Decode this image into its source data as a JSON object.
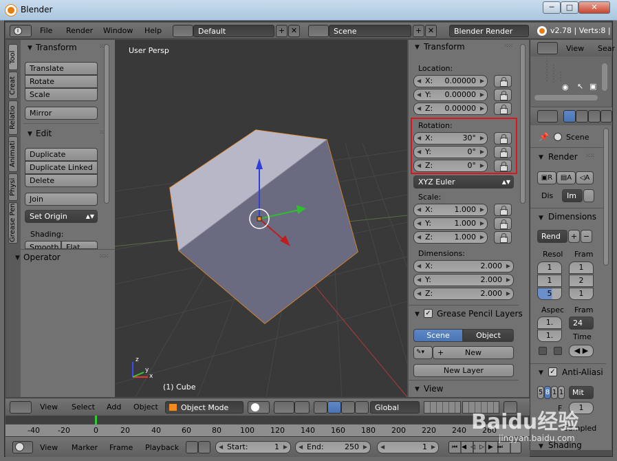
{
  "window": {
    "title": "Blender",
    "min": "─",
    "max": "□",
    "close": "✕"
  },
  "topbar": {
    "menus": [
      "File",
      "Render",
      "Window",
      "Help"
    ],
    "layout": "Default",
    "scene": "Scene",
    "engine": "Blender Render",
    "stats": "v2.78 | Verts:8 |"
  },
  "tool_tabs": [
    "Tool",
    "Creat",
    "Relatio",
    "Animati",
    "Physi",
    "Grease Pen"
  ],
  "tool_panel": {
    "transform_title": "Transform",
    "transform_buttons": [
      "Translate",
      "Rotate",
      "Scale"
    ],
    "mirror": "Mirror",
    "edit_title": "Edit",
    "edit_buttons": [
      "Duplicate",
      "Duplicate Linked",
      "Delete"
    ],
    "join": "Join",
    "set_origin": "Set Origin",
    "shading_label": "Shading:",
    "smooth": "Smooth",
    "flat": "Flat",
    "operator_title": "Operator"
  },
  "viewport": {
    "persp_label": "User Persp",
    "object_label": "(1) Cube",
    "axis_z": "z",
    "axis_x": "x",
    "axis_y": "y"
  },
  "props_panel": {
    "title": "Transform",
    "location_label": "Location:",
    "location": [
      {
        "axis": "X:",
        "value": "0.00000"
      },
      {
        "axis": "Y:",
        "value": "0.00000"
      },
      {
        "axis": "Z:",
        "value": "0.00000"
      }
    ],
    "rotation_label": "Rotation:",
    "rotation": [
      {
        "axis": "X:",
        "value": "30°"
      },
      {
        "axis": "Y:",
        "value": "0°"
      },
      {
        "axis": "Z:",
        "value": "0°"
      }
    ],
    "rotation_mode": "XYZ Euler",
    "scale_label": "Scale:",
    "scale": [
      {
        "axis": "X:",
        "value": "1.000"
      },
      {
        "axis": "Y:",
        "value": "1.000"
      },
      {
        "axis": "Z:",
        "value": "1.000"
      }
    ],
    "dimensions_label": "Dimensions:",
    "dimensions": [
      {
        "axis": "X:",
        "value": "2.000"
      },
      {
        "axis": "Y:",
        "value": "2.000"
      },
      {
        "axis": "Z:",
        "value": "2.000"
      }
    ],
    "gp_layers": "Grease Pencil Layers",
    "gp_scene": "Scene",
    "gp_object": "Object",
    "gp_new": "New",
    "gp_new_layer": "New Layer",
    "view_title": "View"
  },
  "outliner": {
    "view": "View",
    "search": "Sear"
  },
  "properties": {
    "scene": "Scene",
    "render_title": "Render",
    "render_btns": [
      "R",
      "A",
      "A"
    ],
    "display_label": "Dis",
    "display_value": "Im",
    "dimensions_title": "Dimensions",
    "preset": "Rend",
    "resol_label": "Resol",
    "resol_vals": [
      "1",
      "1",
      "5"
    ],
    "frame_label": "Fram",
    "frame_vals": [
      "1",
      "2",
      "1"
    ],
    "aspect_label": "Aspec",
    "aspect_vals": [
      "1.",
      "1."
    ],
    "framerate_label": "Fram",
    "framerate_val": "24",
    "time_label": "Time",
    "aa_title": "Anti-Aliasi",
    "aa_samples": [
      "5",
      "8",
      "1",
      "1"
    ],
    "aa_filter": "Mit",
    "aa_size": "1",
    "aa_full": "F",
    "sampled": "Sampled",
    "shading": "Shading"
  },
  "view3d_header": {
    "menus": [
      "View",
      "Select",
      "Add",
      "Object"
    ],
    "mode": "Object Mode",
    "orientation": "Global"
  },
  "timeline": {
    "ticks": [
      "-40",
      "-20",
      "0",
      "20",
      "40",
      "60",
      "80",
      "100",
      "120",
      "140",
      "160",
      "180",
      "200",
      "220",
      "240",
      "260"
    ],
    "menus": [
      "View",
      "Marker",
      "Frame",
      "Playback"
    ],
    "start_label": "Start:",
    "start_value": "1",
    "end_label": "End:",
    "end_value": "250",
    "current": "1"
  },
  "watermark": {
    "text": "Baidu经验",
    "url": "jingyan.baidu.com"
  },
  "colors": {
    "highlight_box": "#e0141d",
    "selection": "#f28a1e",
    "accent_blue": "#5680c2"
  }
}
